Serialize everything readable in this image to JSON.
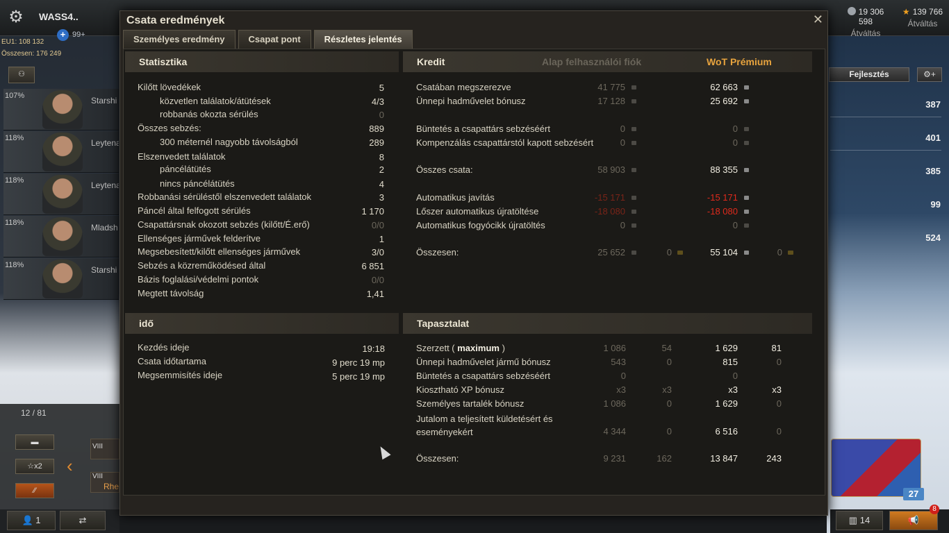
{
  "topbar": {
    "player_name": "WASS4..",
    "plus_count": "99+",
    "server_stat": "EU1: 108 132",
    "total_stat": "Összesen: 176 249",
    "credits": "19 306 598",
    "credits_sub": "Átváltás",
    "gold": "139 766",
    "gold_sub": "Átváltás"
  },
  "crew": [
    {
      "pct": "107%",
      "name": "Starshi"
    },
    {
      "pct": "118%",
      "name": "Leytena"
    },
    {
      "pct": "118%",
      "name": "Leytena"
    },
    {
      "pct": "118%",
      "name": "Mladsh"
    },
    {
      "pct": "118%",
      "name": "Starshi"
    }
  ],
  "left_bottom": {
    "counter": "12 / 81",
    "x2_label": "x2",
    "tier1": "VIII",
    "tier2": "VIII",
    "veh2": "Rhe",
    "players_count": "1"
  },
  "right": {
    "dev_button": "Fejlesztés",
    "values": [
      "387",
      "401",
      "385",
      "99",
      "524"
    ],
    "gift_count": "27",
    "stats_count": "14",
    "notif_count": "8"
  },
  "dialog": {
    "title": "Csata eredmények",
    "tabs": [
      "Személyes eredmény",
      "Csapat pont",
      "Részletes jelentés"
    ],
    "statistics": {
      "header": "Statisztika",
      "rows": [
        {
          "label": "Kilőtt lövedékek",
          "value": "5",
          "indent": false,
          "dim": false
        },
        {
          "label": "közvetlen találatok/átütések",
          "value": "4/3",
          "indent": true,
          "dim": false
        },
        {
          "label": "robbanás okozta sérülés",
          "value": "0",
          "indent": true,
          "dim": true
        },
        {
          "label": "Összes sebzés:",
          "value": "889",
          "indent": false,
          "dim": false
        },
        {
          "label": "300 méternél nagyobb távolságból",
          "value": "289",
          "indent": true,
          "dim": false
        },
        {
          "label": "Elszenvedett találatok",
          "value": "8",
          "indent": false,
          "dim": false
        },
        {
          "label": "páncélátütés",
          "value": "2",
          "indent": true,
          "dim": false
        },
        {
          "label": "nincs páncélátütés",
          "value": "4",
          "indent": true,
          "dim": false
        },
        {
          "label": "Robbanási sérüléstől elszenvedett találatok",
          "value": "3",
          "indent": false,
          "dim": false
        },
        {
          "label": "Páncél által felfogott sérülés",
          "value": "1 170",
          "indent": false,
          "dim": false
        },
        {
          "label": "Csapattársnak okozott sebzés (kilőtt/É.erő)",
          "value": "0/0",
          "indent": false,
          "dim": true
        },
        {
          "label": "Ellenséges járművek felderítve",
          "value": "1",
          "indent": false,
          "dim": false
        },
        {
          "label": "Megsebesített/kilőtt ellenséges járművek",
          "value": "3/0",
          "indent": false,
          "dim": false
        },
        {
          "label": "Sebzés a közreműködésed által",
          "value": "6 851",
          "indent": false,
          "dim": false
        },
        {
          "label": "Bázis foglalási/védelmi pontok",
          "value": "0/0",
          "indent": false,
          "dim": true
        },
        {
          "label": "Megtett távolság",
          "value": "1,41",
          "indent": false,
          "dim": false
        }
      ]
    },
    "time": {
      "header": "idő",
      "rows": [
        {
          "label": "Kezdés ideje",
          "value": "19:18"
        },
        {
          "label": "Csata időtartama",
          "value": "9 perc 19 mp"
        },
        {
          "label": "Megsemmisítés ideje",
          "value": "5 perc 19 mp"
        }
      ]
    },
    "credit": {
      "header": "Kredit",
      "col_basic": "Alap felhasználói fiók",
      "col_premium": "WoT Prémium",
      "rows": [
        {
          "label": "Csatában megszerezve",
          "basic": "41 775",
          "premium": "62 663",
          "red": false,
          "premium_dim": false
        },
        {
          "label": "Ünnepi hadművelet bónusz",
          "basic": "17 128",
          "premium": "25 692",
          "red": false,
          "premium_dim": false
        },
        {
          "label": "Büntetés a csapattárs sebzéséért",
          "basic": "0",
          "premium": "0",
          "red": false,
          "premium_dim": true
        },
        {
          "label": "Kompenzálás csapattárstól kapott sebzésért",
          "basic": "0",
          "premium": "0",
          "red": false,
          "premium_dim": true
        },
        {
          "label": "Összes csata:",
          "basic": "58 903",
          "premium": "88 355",
          "red": false,
          "premium_dim": false
        },
        {
          "label": "Automatikus javítás",
          "basic": "-15 171",
          "premium": "-15 171",
          "red": true,
          "premium_dim": false
        },
        {
          "label": "Lőszer automatikus újratöltése",
          "basic": "-18 080",
          "premium": "-18 080",
          "red": true,
          "premium_dim": false
        },
        {
          "label": "Automatikus fogyócikk újratöltés",
          "basic": "0",
          "premium": "0",
          "red": false,
          "premium_dim": true
        },
        {
          "label": "Összesen:",
          "basic": "25 652",
          "basic_gold": "0",
          "premium": "55 104",
          "premium_gold": "0",
          "red": false,
          "premium_dim": false
        }
      ]
    },
    "experience": {
      "header": "Tapasztalat",
      "earned_label": "Szerzett (",
      "earned_bold": "maximum",
      "earned_close": ")",
      "rows": [
        {
          "label": "Szerzett",
          "b1": "1 086",
          "b2": "54",
          "p1": "1 629",
          "p2": "81"
        },
        {
          "label": "Ünnepi hadművelet jármű bónusz",
          "b1": "543",
          "b2": "0",
          "p1": "815",
          "p2": "0"
        },
        {
          "label": "Büntetés a csapattárs sebzéséért",
          "b1": "0",
          "b2": "",
          "p1": "0",
          "p2": ""
        },
        {
          "label": "Kiosztható XP bónusz",
          "b1": "x3",
          "b2": "x3",
          "p1": "x3",
          "p2": "x3"
        },
        {
          "label": "Személyes tartalék bónusz",
          "b1": "1 086",
          "b2": "0",
          "p1": "1 629",
          "p2": "0"
        },
        {
          "label": "Jutalom a teljesített küldetésért és eseményekért",
          "b1": "4 344",
          "b2": "0",
          "p1": "6 516",
          "p2": "0"
        },
        {
          "label": "Összesen:",
          "b1": "9 231",
          "b2": "162",
          "p1": "13 847",
          "p2": "243"
        }
      ]
    }
  }
}
